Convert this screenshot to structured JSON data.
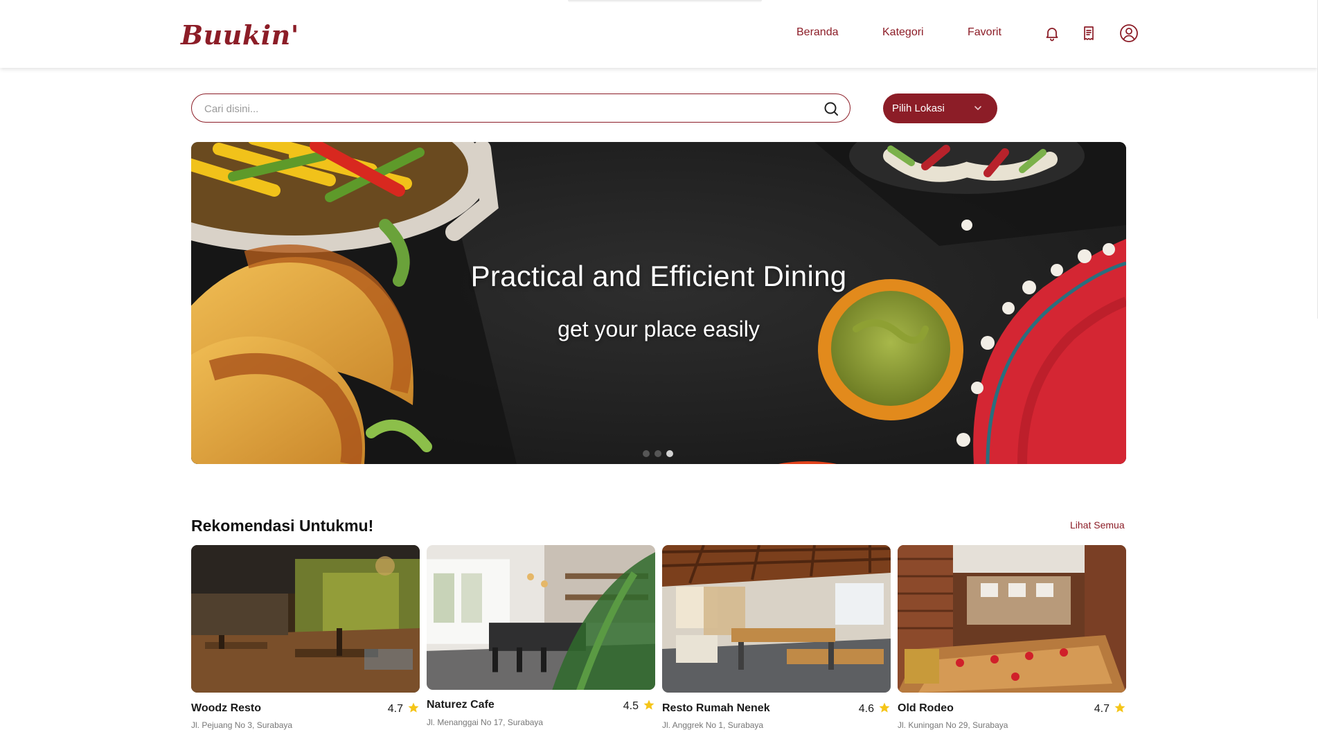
{
  "header": {
    "logo": "Buukin'",
    "nav": [
      {
        "label": "Beranda"
      },
      {
        "label": "Kategori"
      },
      {
        "label": "Favorit"
      }
    ],
    "icons": [
      "bell-icon",
      "receipt-icon",
      "user-account-icon"
    ]
  },
  "search": {
    "placeholder": "Cari disini...",
    "value": ""
  },
  "location": {
    "label": "Pilih Lokasi"
  },
  "hero": {
    "title": "Practical and Efficient Dining",
    "subtitle": "get your place easily",
    "slide_count": 3,
    "active_slide": 3
  },
  "recommendations": {
    "title": "Rekomendasi Untukmu!",
    "see_all": "Lihat Semua",
    "items": [
      {
        "name": "Woodz Resto",
        "rating": "4.7",
        "address": "Jl. Pejuang No 3, Surabaya"
      },
      {
        "name": "Naturez Cafe",
        "rating": "4.5",
        "address": "Jl. Menanggai No 17, Surabaya"
      },
      {
        "name": "Resto Rumah Nenek",
        "rating": "4.6",
        "address": "Jl. Anggrek No 1, Surabaya"
      },
      {
        "name": "Old Rodeo",
        "rating": "4.7",
        "address": "Jl. Kuningan No 29, Surabaya"
      }
    ]
  },
  "colors": {
    "brand": "#8c1d27",
    "star": "#f5c518"
  }
}
